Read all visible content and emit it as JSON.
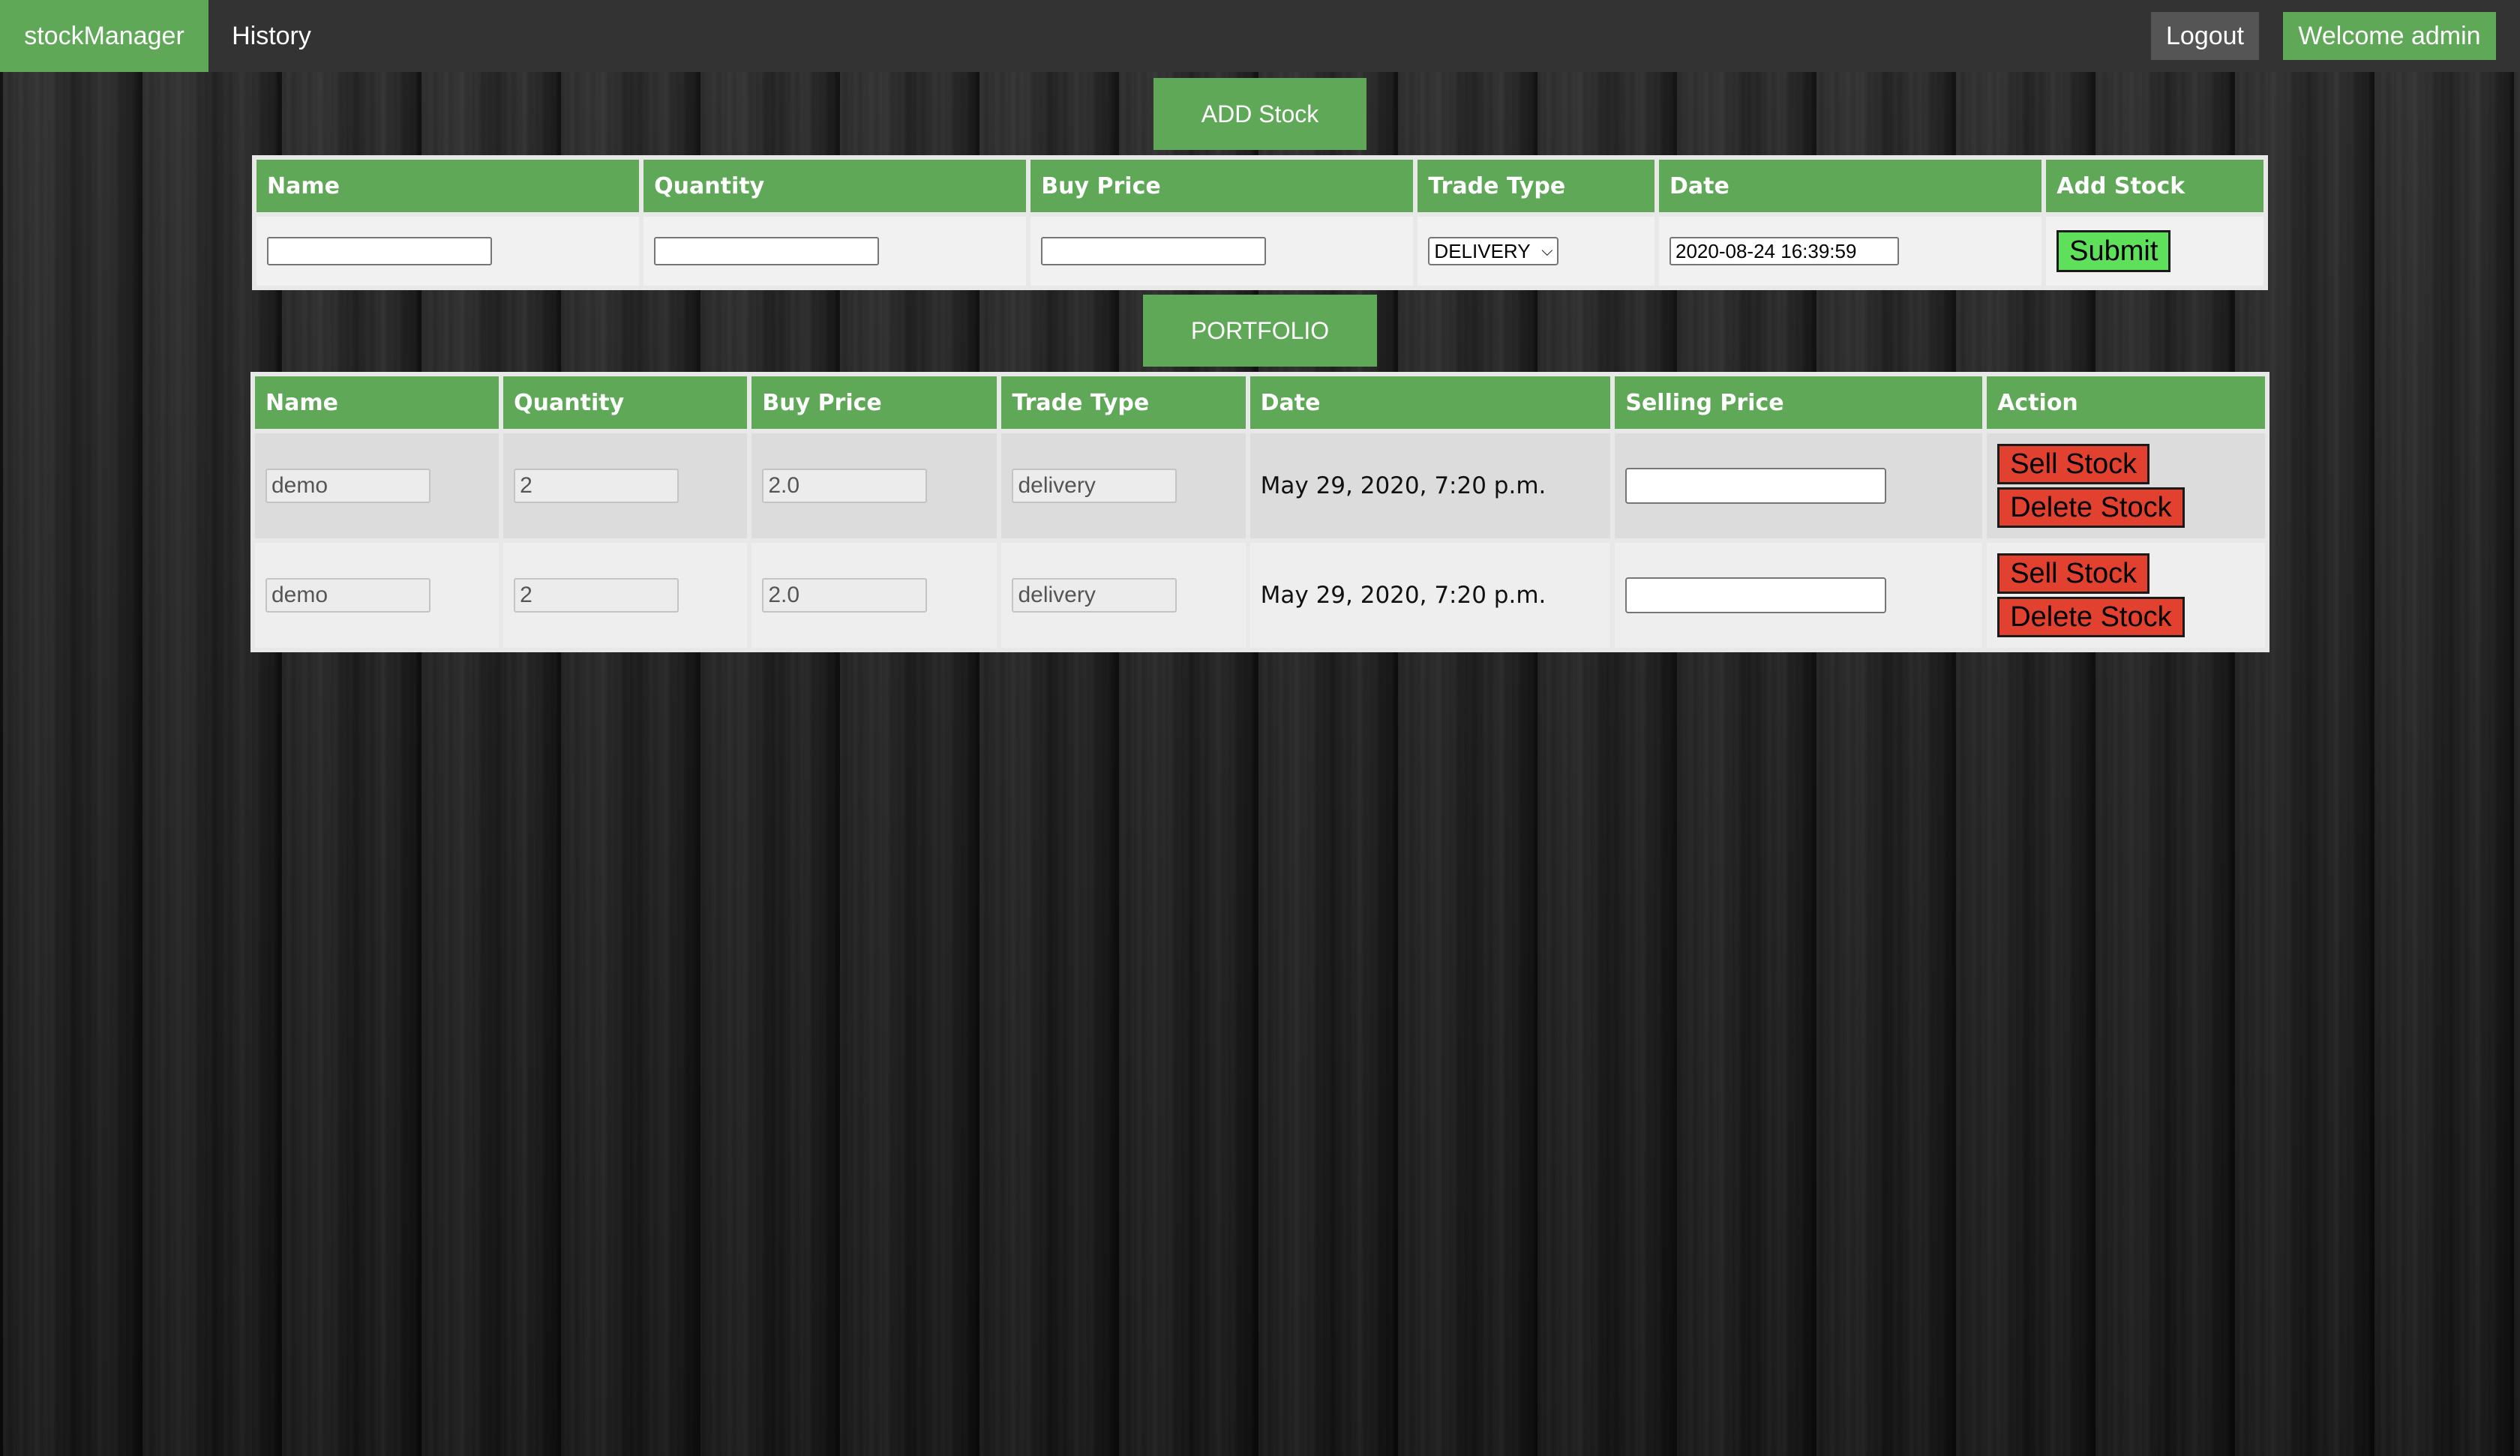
{
  "navbar": {
    "brand": "stockManager",
    "history_link": "History",
    "logout_label": "Logout",
    "welcome_text": "Welcome admin"
  },
  "add_stock": {
    "heading": "ADD Stock",
    "columns": [
      "Name",
      "Quantity",
      "Buy Price",
      "Trade Type",
      "Date",
      "Add Stock"
    ],
    "trade_type_selected": "DELIVERY",
    "date_value": "2020-08-24 16:39:59",
    "submit_label": "Submit"
  },
  "portfolio": {
    "heading": "PORTFOLIO",
    "columns": [
      "Name",
      "Quantity",
      "Buy Price",
      "Trade Type",
      "Date",
      "Selling Price",
      "Action"
    ],
    "rows": [
      {
        "name": "demo",
        "quantity": "2",
        "buy_price": "2.0",
        "trade_type": "delivery",
        "date": "May 29, 2020, 7:20 p.m.",
        "sell_label": "Sell Stock",
        "delete_label": "Delete Stock"
      },
      {
        "name": "demo",
        "quantity": "2",
        "buy_price": "2.0",
        "trade_type": "delivery",
        "date": "May 29, 2020, 7:20 p.m.",
        "sell_label": "Sell Stock",
        "delete_label": "Delete Stock"
      }
    ]
  },
  "colors": {
    "accent_green": "#5fa857",
    "navbar_bg": "#333333",
    "submit_green": "#5fe05a",
    "danger_red": "#e2412f"
  }
}
